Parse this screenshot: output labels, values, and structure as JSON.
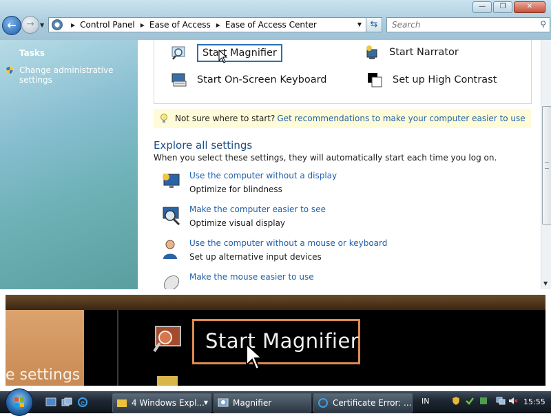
{
  "window": {
    "minimize": "—",
    "maximize": "❐",
    "close": "✕"
  },
  "nav": {
    "back_icon": "back-arrow",
    "forward_icon": "forward-arrow",
    "breadcrumbs": [
      "Control Panel",
      "Ease of Access",
      "Ease of Access Center"
    ],
    "search_placeholder": "Search"
  },
  "sidebar": {
    "tasks_heading": "Tasks",
    "admin_link": "Change administrative settings"
  },
  "quick_access": {
    "start_magnifier": "Start Magnifier",
    "start_narrator": "Start Narrator",
    "start_osk": "Start On-Screen Keyboard",
    "high_contrast": "Set up High Contrast"
  },
  "hint": {
    "prefix": "Not sure where to start?",
    "link": "Get recommendations to make your computer easier to use"
  },
  "explore": {
    "title": "Explore all settings",
    "subtitle": "When you select these settings, they will automatically start each time you log on.",
    "items": [
      {
        "link": "Use the computer without a display",
        "desc": "Optimize for blindness"
      },
      {
        "link": "Make the computer easier to see",
        "desc": "Optimize visual display"
      },
      {
        "link": "Use the computer without a mouse or keyboard",
        "desc": "Set up alternative input devices"
      },
      {
        "link": "Make the mouse easier to use",
        "desc": ""
      }
    ]
  },
  "magnifier_view": {
    "zoomed_label": "Start Magnifier",
    "side_text": "e settings"
  },
  "taskbar": {
    "buttons": [
      {
        "label": "4 Windows Expl..."
      },
      {
        "label": "Magnifier"
      },
      {
        "label": "Certificate Error: ..."
      }
    ],
    "language": "IN",
    "clock": "15:55"
  },
  "colors": {
    "link": "#1f5fa8",
    "focus": "#2b6fb6",
    "magnifier_highlight": "#e08a52",
    "hint_bg": "#fefcd8"
  }
}
